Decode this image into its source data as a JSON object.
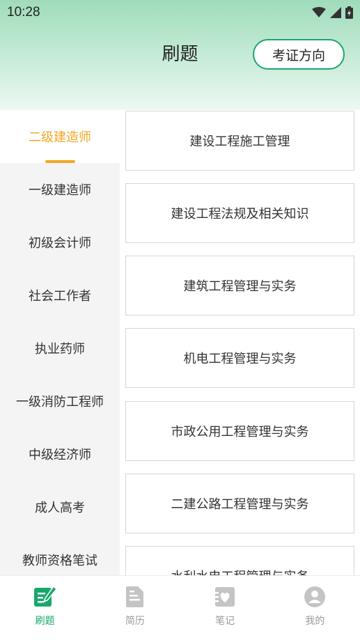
{
  "status_bar": {
    "time": "10:28"
  },
  "header": {
    "title": "刷题",
    "direction_button": "考证方向"
  },
  "sidebar": {
    "items": [
      {
        "label": "二级建造师",
        "active": true
      },
      {
        "label": "一级建造师",
        "active": false
      },
      {
        "label": "初级会计师",
        "active": false
      },
      {
        "label": "社会工作者",
        "active": false
      },
      {
        "label": "执业药师",
        "active": false
      },
      {
        "label": "一级消防工程师",
        "active": false
      },
      {
        "label": "中级经济师",
        "active": false
      },
      {
        "label": "成人高考",
        "active": false
      },
      {
        "label": "教师资格笔试",
        "active": false
      }
    ]
  },
  "courses": [
    "建设工程施工管理",
    "建设工程法规及相关知识",
    "建筑工程管理与实务",
    "机电工程管理与实务",
    "市政公用工程管理与实务",
    "二建公路工程管理与实务",
    "水利水电工程管理与实务"
  ],
  "tabbar": {
    "items": [
      {
        "label": "刷题",
        "icon": "edit-icon",
        "active": true
      },
      {
        "label": "简历",
        "icon": "document-icon",
        "active": false
      },
      {
        "label": "笔记",
        "icon": "notes-heart-icon",
        "active": false
      },
      {
        "label": "我的",
        "icon": "user-icon",
        "active": false
      }
    ]
  },
  "colors": {
    "accent": "#18a86b",
    "active_category": "#f5a623"
  }
}
